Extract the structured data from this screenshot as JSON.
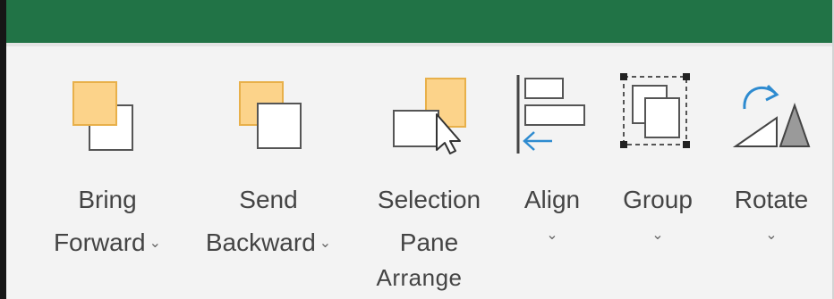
{
  "ribbon": {
    "group_label": "Arrange",
    "buttons": [
      {
        "id": "bring-forward",
        "line1": "Bring",
        "line2": "Forward",
        "has_dropdown": true,
        "icon": "bring-forward-icon"
      },
      {
        "id": "send-backward",
        "line1": "Send",
        "line2": "Backward",
        "has_dropdown": true,
        "icon": "send-backward-icon"
      },
      {
        "id": "selection-pane",
        "line1": "Selection",
        "line2": "Pane",
        "has_dropdown": false,
        "icon": "selection-pane-icon"
      },
      {
        "id": "align",
        "line1": "Align",
        "line2": "",
        "has_dropdown": true,
        "icon": "align-icon"
      },
      {
        "id": "group",
        "line1": "Group",
        "line2": "",
        "has_dropdown": true,
        "icon": "group-objects-icon"
      },
      {
        "id": "rotate",
        "line1": "Rotate",
        "line2": "",
        "has_dropdown": true,
        "icon": "rotate-icon"
      }
    ],
    "dropdown_glyph": "⌄"
  },
  "colors": {
    "title_bar": "#217346",
    "ribbon_bg": "#f3f3f3",
    "shape_fill": "#fcd38a",
    "shape_stroke": "#e8b04a",
    "arrow_blue": "#2e8bd0",
    "text": "#444444"
  }
}
